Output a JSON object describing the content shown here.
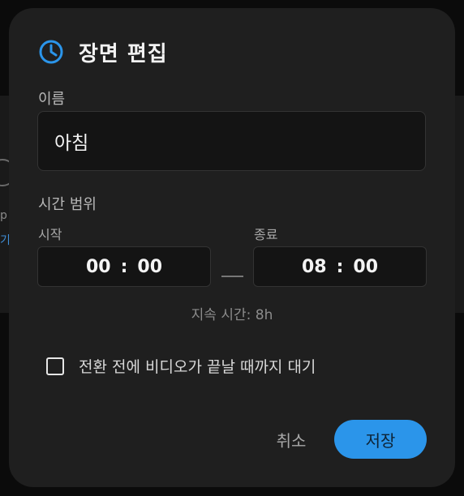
{
  "dialog": {
    "title": "장면 편집",
    "icon": "clock-icon",
    "accent_color": "#2b95ea"
  },
  "name_field": {
    "label": "이름",
    "value": "아침"
  },
  "time_range": {
    "label": "시간 범위",
    "start": {
      "label": "시작",
      "hour": "00",
      "minute": "00"
    },
    "end": {
      "label": "종료",
      "hour": "08",
      "minute": "00"
    },
    "separator": ":",
    "duration_text": "지속 시간: 8h"
  },
  "wait_option": {
    "label": "전환 전에 비디오가 끝날 때까지 대기",
    "checked": false
  },
  "actions": {
    "cancel_label": "취소",
    "save_label": "저장"
  },
  "background": {
    "fragment_1": "p",
    "fragment_2": "기"
  }
}
